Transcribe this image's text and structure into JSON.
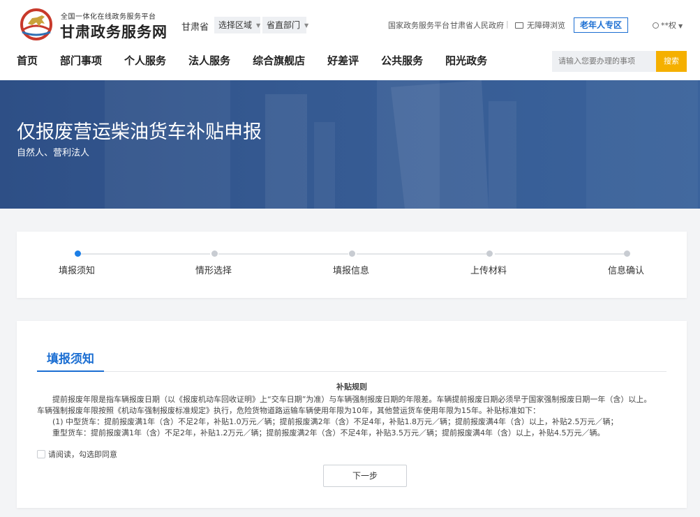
{
  "header": {
    "logo_icon": "horse-logo-icon",
    "logo_subtitle": "全国一体化在线政务服务平台",
    "logo_title": "甘肃政务服务网",
    "province": "甘肃省",
    "region_select": "选择区域",
    "dept_select": "省直部门",
    "links": {
      "national": "国家政务服务平台",
      "provincial_gov": "甘肃省人民政府",
      "separator": "|",
      "accessibility": "无障碍浏览"
    },
    "elder_zone": "老年人专区",
    "user_name": "**权"
  },
  "nav": {
    "items": [
      "首页",
      "部门事项",
      "个人服务",
      "法人服务",
      "综合旗舰店",
      "好差评",
      "公共服务",
      "阳光政务"
    ]
  },
  "search": {
    "placeholder": "请输入您要办理的事项",
    "button": "搜索"
  },
  "banner": {
    "title": "仅报废营运柴油货车补贴申报",
    "subtitle": "自然人、营利法人"
  },
  "steps": {
    "items": [
      "填报须知",
      "情形选择",
      "填报信息",
      "上传材料",
      "信息确认"
    ],
    "active_index": 0
  },
  "content": {
    "tab": "填报须知",
    "rules_title": "补贴规则",
    "rules": [
      "提前报废年限是指车辆报废日期（以《报废机动车回收证明》上“交车日期”为准）与车辆强制报废日期的年限差。车辆提前报废日期必须早于国家强制报废日期一年（含）以上。",
      "车辆强制报废年限按照《机动车强制报废标准规定》执行，危险货物道路运输车辆使用年限为10年，其他营运货车使用年限为15年。补贴标准如下：",
      "(1) 中型货车：提前报废满1年（含）不足2年，补贴1.0万元／辆；提前报废满2年（含）不足4年，补贴1.8万元／辆；提前报废满4年（含）以上，补贴2.5万元／辆；",
      "重型货车：提前报废满1年（含）不足2年，补贴1.2万元／辆；提前报废满2年（含）不足4年，补贴3.5万元／辆；提前报废满4年（含）以上，补贴4.5万元／辆。"
    ],
    "agree_text": "请阅读，勾选即同意",
    "next_button": "下一步"
  },
  "colors": {
    "accent": "#1b6ed2",
    "search_button": "#f5b000",
    "banner": "#355a92"
  }
}
